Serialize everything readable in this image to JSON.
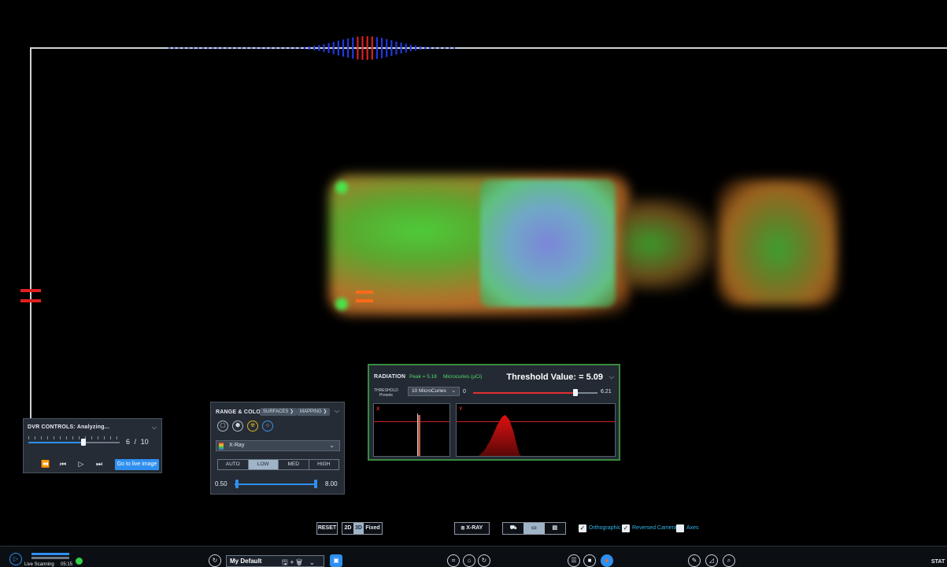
{
  "dvr": {
    "title": "DVR CONTROLS: Analyzing...",
    "frame_current": "6",
    "frame_sep": "/",
    "frame_total": "10",
    "progress": 0.6,
    "live_button": "Go to live image"
  },
  "range_color": {
    "title": "RANGE & COLOR",
    "tab_surfaces": "SURFACES",
    "tab_mapping": "MAPPING",
    "colormap": "X-Ray",
    "levels": [
      "AUTO",
      "LOW",
      "MED",
      "HIGH"
    ],
    "selected_level": "LOW",
    "min_value": "0.50",
    "max_value": "8.00"
  },
  "radiation": {
    "title": "RADIATION",
    "peak": "Peak = 5.18",
    "unit": "Microcuries (μCi)",
    "threshold_label": "Threshold Value: = 5.09",
    "presets_label_1": "THRESHOLD",
    "presets_label_2": "Presets",
    "preset_value": "10 MicroCuries",
    "range_min": "0",
    "range_max": "6.21",
    "threshold_fraction": 0.82,
    "hist_x_label": "X",
    "hist_y_label": "Y"
  },
  "toolbar": {
    "reset": "RESET",
    "mode_2d": "2D",
    "mode_3d": "3D",
    "fixed": "Fixed",
    "xray": "X-RAY",
    "orthographic": "Orthographic",
    "reversed_camera": "Reversed Camera",
    "axes": "Axes"
  },
  "statusbar": {
    "live_scanning": "Live Scanning",
    "clock": "05:15",
    "profile": "My Default",
    "status": "STAT"
  },
  "colors": {
    "accent": "#2f8ff0",
    "radiation_border": "#3a8a3e",
    "alert_red": "#e02020",
    "peak_green": "#53d86a",
    "checkbox_label": "#2fb4e8"
  }
}
